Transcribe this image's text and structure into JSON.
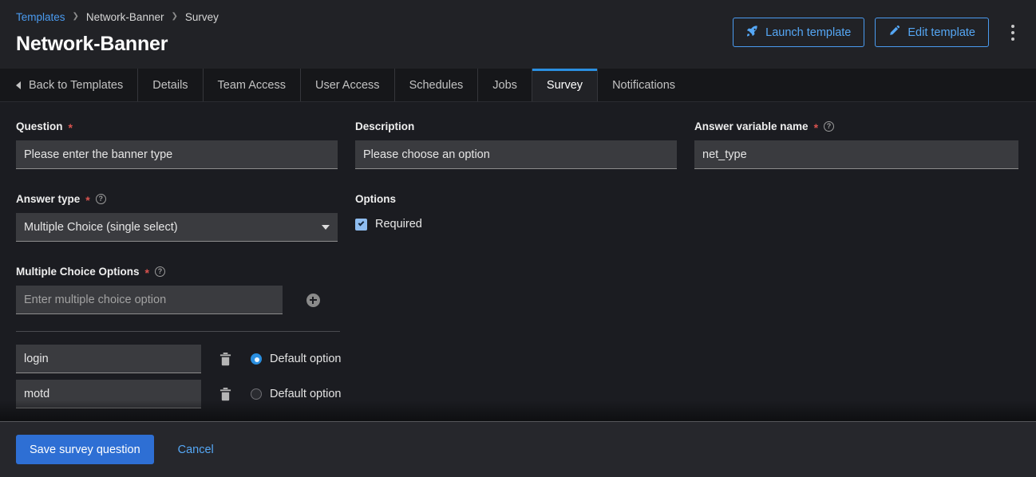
{
  "header": {
    "breadcrumb": [
      {
        "label": "Templates",
        "link": true
      },
      {
        "label": "Network-Banner",
        "link": false
      },
      {
        "label": "Survey",
        "link": false
      }
    ],
    "separator": "❯",
    "title": "Network-Banner",
    "launch_label": "Launch template",
    "edit_label": "Edit template",
    "launch_icon": "rocket-icon",
    "edit_icon": "pencil-icon",
    "kebab_icon": "kebab-menu-icon"
  },
  "tabs": [
    {
      "label": "Back to Templates",
      "active": false,
      "back": true
    },
    {
      "label": "Details",
      "active": false
    },
    {
      "label": "Team Access",
      "active": false
    },
    {
      "label": "User Access",
      "active": false
    },
    {
      "label": "Schedules",
      "active": false
    },
    {
      "label": "Jobs",
      "active": false
    },
    {
      "label": "Survey",
      "active": true
    },
    {
      "label": "Notifications",
      "active": false
    }
  ],
  "form": {
    "question": {
      "label": "Question",
      "required": true,
      "value": "Please enter the banner type"
    },
    "description": {
      "label": "Description",
      "required": false,
      "value": "Please choose an option"
    },
    "answer_variable": {
      "label": "Answer variable name",
      "required": true,
      "help": "?",
      "value": "net_type"
    },
    "answer_type": {
      "label": "Answer type",
      "required": true,
      "help": "?",
      "value": "Multiple Choice (single select)"
    },
    "options_group": {
      "label": "Options",
      "required_checkbox": {
        "label": "Required",
        "checked": true
      }
    },
    "multiple_choice": {
      "label": "Multiple Choice Options",
      "required": true,
      "help": "?",
      "placeholder": "Enter multiple choice option",
      "value": "",
      "add_icon": "plus-circle-icon",
      "default_label": "Default option",
      "delete_icon": "trash-icon",
      "items": [
        {
          "value": "login",
          "is_default": true
        },
        {
          "value": "motd",
          "is_default": false
        }
      ]
    }
  },
  "footer": {
    "save_label": "Save survey question",
    "cancel_label": "Cancel"
  },
  "colors": {
    "accent_blue": "#2a8fe0",
    "link_blue": "#55a7f5",
    "primary_button": "#2e6fd4",
    "required_star": "#d9534f",
    "page_background": "#1b1c21",
    "header_background": "#212226",
    "tabbar_background": "#16171a",
    "input_background": "#3a3b3f"
  }
}
